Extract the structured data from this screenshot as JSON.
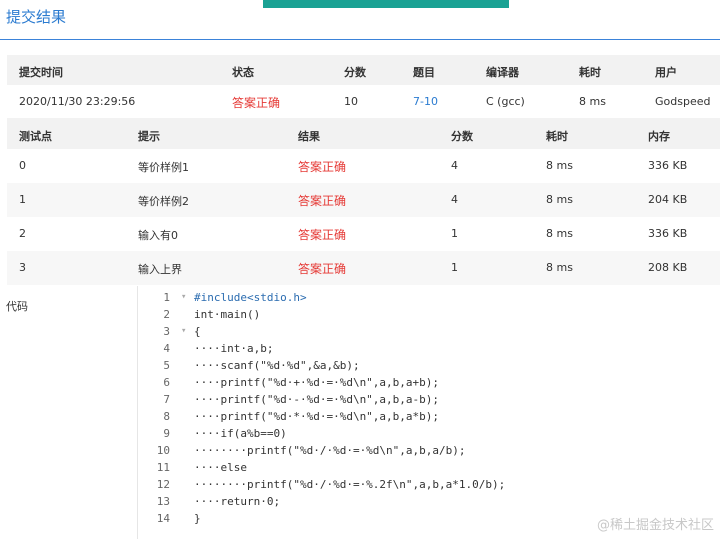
{
  "page": {
    "title": "提交结果",
    "accent": "#1aa294",
    "link_color": "#2b7bd0",
    "status_color": "#e53935"
  },
  "submission": {
    "headers": [
      "提交时间",
      "状态",
      "分数",
      "题目",
      "编译器",
      "耗时",
      "用户"
    ],
    "values": [
      "2020/11/30 23:29:56",
      "答案正确",
      "10",
      "7-10",
      "C (gcc)",
      "8 ms",
      "Godspeed"
    ]
  },
  "tests": {
    "headers": [
      "测试点",
      "提示",
      "结果",
      "分数",
      "耗时",
      "内存"
    ],
    "rows": [
      [
        "0",
        "等价样例1",
        "答案正确",
        "4",
        "8 ms",
        "336 KB"
      ],
      [
        "1",
        "等价样例2",
        "答案正确",
        "4",
        "8 ms",
        "204 KB"
      ],
      [
        "2",
        "输入有0",
        "答案正确",
        "1",
        "8 ms",
        "336 KB"
      ],
      [
        "3",
        "输入上界",
        "答案正确",
        "1",
        "8 ms",
        "208 KB"
      ]
    ]
  },
  "code": {
    "label": "代码",
    "lines": [
      "#include<stdio.h>",
      "int·main()",
      "{",
      "····int·a,b;",
      "····scanf(\"%d·%d\",&a,&b);",
      "····printf(\"%d·+·%d·=·%d\\n\",a,b,a+b);",
      "····printf(\"%d·-·%d·=·%d\\n\",a,b,a-b);",
      "····printf(\"%d·*·%d·=·%d\\n\",a,b,a*b);",
      "····if(a%b==0)",
      "········printf(\"%d·/·%d·=·%d\\n\",a,b,a/b);",
      "····else",
      "········printf(\"%d·/·%d·=·%.2f\\n\",a,b,a*1.0/b);",
      "····return·0;",
      "}"
    ],
    "fold_icon": "chevron-down-icon"
  },
  "watermark": "@稀土掘金技术社区"
}
